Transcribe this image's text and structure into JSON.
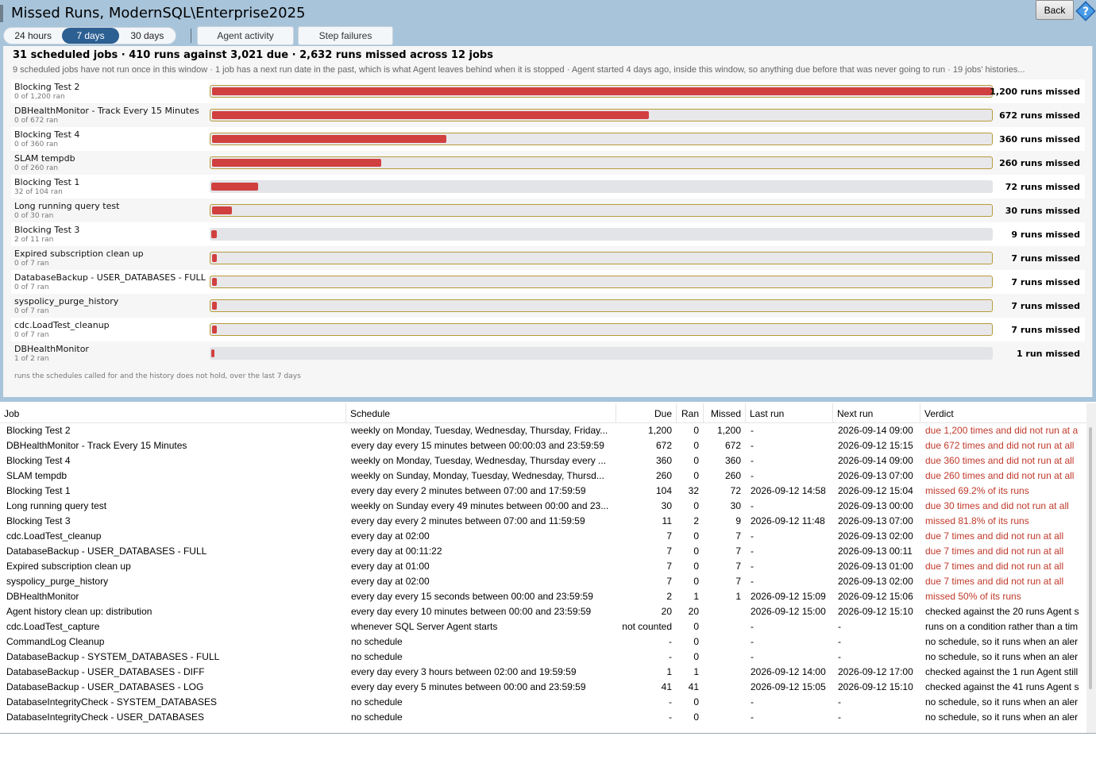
{
  "window": {
    "title": "Missed Runs, ModernSQL\\Enterprise2025",
    "back_label": "Back"
  },
  "range_tabs": [
    {
      "label": "24 hours",
      "active": false
    },
    {
      "label": "7 days",
      "active": true
    },
    {
      "label": "30 days",
      "active": false
    }
  ],
  "nav_buttons": {
    "agent_activity": "Agent activity",
    "step_failures": "Step failures"
  },
  "summary": {
    "stats": "31 scheduled jobs   ·   410 runs against 3,021 due   ·   2,632 runs missed across 12 jobs",
    "notes": "9 scheduled jobs have not run once in this window   ·   1 job has a next run date in the past, which is what Agent leaves behind when it is stopped   ·   Agent started 4 days ago, inside this window, so anything due before that was never going to run   ·   19 jobs' histories..."
  },
  "bars": [
    {
      "name": "Blocking Test 2",
      "sub": "0 of 1,200 ran",
      "missed": 1200,
      "count_label": "1,200 runs missed",
      "none_ran": true
    },
    {
      "name": "DBHealthMonitor - Track Every 15 Minutes",
      "sub": "0 of 672 ran",
      "missed": 672,
      "count_label": "672 runs missed",
      "none_ran": true
    },
    {
      "name": "Blocking Test 4",
      "sub": "0 of 360 ran",
      "missed": 360,
      "count_label": "360 runs missed",
      "none_ran": true
    },
    {
      "name": "SLAM tempdb",
      "sub": "0 of 260 ran",
      "missed": 260,
      "count_label": "260 runs missed",
      "none_ran": true
    },
    {
      "name": "Blocking Test 1",
      "sub": "32 of 104 ran",
      "missed": 72,
      "count_label": "72 runs missed",
      "none_ran": false
    },
    {
      "name": "Long running query test",
      "sub": "0 of 30 ran",
      "missed": 30,
      "count_label": "30 runs missed",
      "none_ran": true
    },
    {
      "name": "Blocking Test 3",
      "sub": "2 of 11 ran",
      "missed": 9,
      "count_label": "9 runs missed",
      "none_ran": false
    },
    {
      "name": "Expired subscription clean up",
      "sub": "0 of 7 ran",
      "missed": 7,
      "count_label": "7 runs missed",
      "none_ran": true
    },
    {
      "name": "DatabaseBackup - USER_DATABASES - FULL",
      "sub": "0 of 7 ran",
      "missed": 7,
      "count_label": "7 runs missed",
      "none_ran": true
    },
    {
      "name": "syspolicy_purge_history",
      "sub": "0 of 7 ran",
      "missed": 7,
      "count_label": "7 runs missed",
      "none_ran": true
    },
    {
      "name": "cdc.LoadTest_cleanup",
      "sub": "0 of 7 ran",
      "missed": 7,
      "count_label": "7 runs missed",
      "none_ran": true
    },
    {
      "name": "DBHealthMonitor",
      "sub": "1 of 2 ran",
      "missed": 1,
      "count_label": "1 run missed",
      "none_ran": false
    }
  ],
  "bars_max": 1200,
  "bars_footnote": "runs the schedules called for and the history does not hold, over the last 7 days",
  "grid": {
    "columns": {
      "job": "Job",
      "schedule": "Schedule",
      "due": "Due",
      "ran": "Ran",
      "missed": "Missed",
      "last_run": "Last run",
      "next_run": "Next run",
      "verdict": "Verdict"
    },
    "rows": [
      {
        "job": "Blocking Test 2",
        "schedule": "weekly on Monday, Tuesday, Wednesday, Thursday, Friday...",
        "due": "1,200",
        "ran": "0",
        "missed": "1,200",
        "last_run": "-",
        "next_run": "2026-09-14 09:00",
        "verdict": "due 1,200 times and did not run at a",
        "red": true
      },
      {
        "job": "DBHealthMonitor - Track Every 15 Minutes",
        "schedule": "every day every 15 minutes between 00:00:03 and 23:59:59",
        "due": "672",
        "ran": "0",
        "missed": "672",
        "last_run": "-",
        "next_run": "2026-09-12 15:15",
        "verdict": "due 672 times and did not run at all",
        "red": true
      },
      {
        "job": "Blocking Test 4",
        "schedule": "weekly on Monday, Tuesday, Wednesday, Thursday every ...",
        "due": "360",
        "ran": "0",
        "missed": "360",
        "last_run": "-",
        "next_run": "2026-09-14 09:00",
        "verdict": "due 360 times and did not run at all",
        "red": true
      },
      {
        "job": "SLAM tempdb",
        "schedule": "weekly on Sunday, Monday, Tuesday, Wednesday, Thursd...",
        "due": "260",
        "ran": "0",
        "missed": "260",
        "last_run": "-",
        "next_run": "2026-09-13 07:00",
        "verdict": "due 260 times and did not run at all",
        "red": true
      },
      {
        "job": "Blocking Test 1",
        "schedule": "every day every 2 minutes between 07:00 and 17:59:59",
        "due": "104",
        "ran": "32",
        "missed": "72",
        "last_run": "2026-09-12 14:58",
        "next_run": "2026-09-12 15:04",
        "verdict": "missed 69.2% of its runs",
        "red": true
      },
      {
        "job": "Long running query test",
        "schedule": "weekly on Sunday every 49 minutes between 00:00 and 23...",
        "due": "30",
        "ran": "0",
        "missed": "30",
        "last_run": "-",
        "next_run": "2026-09-13 00:00",
        "verdict": "due 30 times and did not run at all",
        "red": true
      },
      {
        "job": "Blocking Test 3",
        "schedule": "every day every 2 minutes between 07:00 and 11:59:59",
        "due": "11",
        "ran": "2",
        "missed": "9",
        "last_run": "2026-09-12 11:48",
        "next_run": "2026-09-13 07:00",
        "verdict": "missed 81.8% of its runs",
        "red": true
      },
      {
        "job": "cdc.LoadTest_cleanup",
        "schedule": "every day at 02:00",
        "due": "7",
        "ran": "0",
        "missed": "7",
        "last_run": "-",
        "next_run": "2026-09-13 02:00",
        "verdict": "due 7 times and did not run at all",
        "red": true
      },
      {
        "job": "DatabaseBackup - USER_DATABASES - FULL",
        "schedule": "every day at 00:11:22",
        "due": "7",
        "ran": "0",
        "missed": "7",
        "last_run": "-",
        "next_run": "2026-09-13 00:11",
        "verdict": "due 7 times and did not run at all",
        "red": true
      },
      {
        "job": "Expired subscription clean up",
        "schedule": "every day at 01:00",
        "due": "7",
        "ran": "0",
        "missed": "7",
        "last_run": "-",
        "next_run": "2026-09-13 01:00",
        "verdict": "due 7 times and did not run at all",
        "red": true
      },
      {
        "job": "syspolicy_purge_history",
        "schedule": "every day at 02:00",
        "due": "7",
        "ran": "0",
        "missed": "7",
        "last_run": "-",
        "next_run": "2026-09-13 02:00",
        "verdict": "due 7 times and did not run at all",
        "red": true
      },
      {
        "job": "DBHealthMonitor",
        "schedule": "every day every 15 seconds between 00:00 and 23:59:59",
        "due": "2",
        "ran": "1",
        "missed": "1",
        "last_run": "2026-09-12 15:09",
        "next_run": "2026-09-12 15:06",
        "verdict": "missed 50% of its runs",
        "red": true
      },
      {
        "job": "Agent history clean up: distribution",
        "schedule": "every day every 10 minutes between 00:00 and 23:59:59",
        "due": "20",
        "ran": "20",
        "missed": "",
        "last_run": "2026-09-12 15:00",
        "next_run": "2026-09-12 15:10",
        "verdict": "checked against the 20 runs Agent s",
        "red": false
      },
      {
        "job": "cdc.LoadTest_capture",
        "schedule": "whenever SQL Server Agent starts",
        "due": "not counted",
        "ran": "0",
        "missed": "",
        "last_run": "-",
        "next_run": "-",
        "verdict": "runs on a condition rather than a tim",
        "red": false
      },
      {
        "job": "CommandLog Cleanup",
        "schedule": "no schedule",
        "due": "-",
        "ran": "0",
        "missed": "",
        "last_run": "-",
        "next_run": "-",
        "verdict": "no schedule, so it runs when an aler",
        "red": false
      },
      {
        "job": "DatabaseBackup - SYSTEM_DATABASES - FULL",
        "schedule": "no schedule",
        "due": "-",
        "ran": "0",
        "missed": "",
        "last_run": "-",
        "next_run": "-",
        "verdict": "no schedule, so it runs when an aler",
        "red": false
      },
      {
        "job": "DatabaseBackup - USER_DATABASES - DIFF",
        "schedule": "every day every 3 hours between 02:00 and 19:59:59",
        "due": "1",
        "ran": "1",
        "missed": "",
        "last_run": "2026-09-12 14:00",
        "next_run": "2026-09-12 17:00",
        "verdict": "checked against the 1 run Agent still",
        "red": false
      },
      {
        "job": "DatabaseBackup - USER_DATABASES - LOG",
        "schedule": "every day every 5 minutes between 00:00 and 23:59:59",
        "due": "41",
        "ran": "41",
        "missed": "",
        "last_run": "2026-09-12 15:05",
        "next_run": "2026-09-12 15:10",
        "verdict": "checked against the 41 runs Agent s",
        "red": false
      },
      {
        "job": "DatabaseIntegrityCheck - SYSTEM_DATABASES",
        "schedule": "no schedule",
        "due": "-",
        "ran": "0",
        "missed": "",
        "last_run": "-",
        "next_run": "-",
        "verdict": "no schedule, so it runs when an aler",
        "red": false
      },
      {
        "job": "DatabaseIntegrityCheck - USER_DATABASES",
        "schedule": "no schedule",
        "due": "-",
        "ran": "0",
        "missed": "",
        "last_run": "-",
        "next_run": "-",
        "verdict": "no schedule, so it runs when an aler",
        "red": false
      }
    ]
  }
}
